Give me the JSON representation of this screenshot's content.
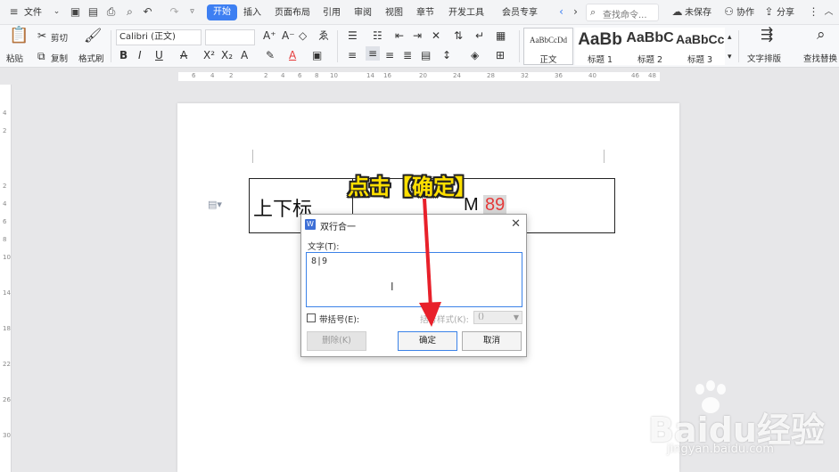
{
  "menu": {
    "hamburger": "≡",
    "file": "文件",
    "tabs": [
      "开始",
      "插入",
      "页面布局",
      "引用",
      "审阅",
      "视图",
      "章节",
      "开发工具",
      "会员专享"
    ],
    "active_tab": "开始",
    "search_placeholder": "查找命令...",
    "unsaved": "未保存",
    "collab": "协作",
    "share": "分享",
    "more": "⋮",
    "collapse": "︿"
  },
  "ribbon": {
    "paste": "粘贴",
    "cut": "剪切",
    "copy": "复制",
    "format_painter": "格式刷",
    "font_name": "Calibri (正文)",
    "font_size": "",
    "bold": "B",
    "italic": "I",
    "underline": "U",
    "strike": "A",
    "superscript": "X²",
    "subscript": "X₂",
    "font_color": "A",
    "styles": [
      {
        "preview": "AaBbCcDd",
        "label": "正文"
      },
      {
        "preview": "AaBb",
        "label": "标题 1"
      },
      {
        "preview": "AaBbC",
        "label": "标题 2"
      },
      {
        "preview": "AaBbCc",
        "label": "标题 3"
      }
    ],
    "text_layout": "文字排版",
    "find_replace": "查找替换"
  },
  "document": {
    "cell_text": "上下标",
    "cell_m": "M",
    "cell_89": "89"
  },
  "dialog": {
    "title": "双行合一",
    "text_label": "文字(T):",
    "text_value": "8|9",
    "brackets_label": "带括号(E):",
    "bracket_style_label": "括号样式(K):",
    "bracket_style_value": "()",
    "delete_button": "删除(K)",
    "ok_button": "确定",
    "cancel_button": "取消"
  },
  "annotation": {
    "callout": "点击【确定】",
    "color": "#ffe000",
    "arrow_color": "#e8202a"
  },
  "watermark": {
    "logo": "Baidu经验",
    "url": "jingyan.baidu.com"
  },
  "colors": {
    "accent": "#3d7ff2",
    "red_text": "#e53a3a"
  }
}
